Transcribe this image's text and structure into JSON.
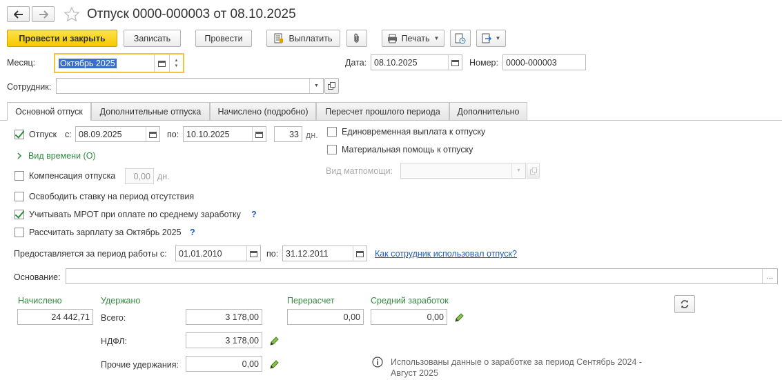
{
  "header": {
    "back_icon": "arrow-left-icon",
    "forward_icon": "arrow-right-icon",
    "star_icon": "star-icon",
    "title": "Отпуск 0000-000003 от 08.10.2025"
  },
  "toolbar": {
    "post_close_label": "Провести и закрыть",
    "save_label": "Записать",
    "post_label": "Провести",
    "pay_label": "Выплатить",
    "print_label": "Печать"
  },
  "fields": {
    "month_label": "Месяц:",
    "month_value": "Октябрь 2025",
    "date_label": "Дата:",
    "date_value": "08.10.2025",
    "number_label": "Номер:",
    "number_value": "0000-000003",
    "employee_label": "Сотрудник:",
    "employee_value": ""
  },
  "tabs": [
    {
      "label": "Основной отпуск"
    },
    {
      "label": "Дополнительные отпуска"
    },
    {
      "label": "Начислено (подробно)"
    },
    {
      "label": "Пересчет прошлого периода"
    },
    {
      "label": "Дополнительно"
    }
  ],
  "main": {
    "vacation_label": "Отпуск",
    "from_label": "с:",
    "from_value": "08.09.2025",
    "to_label": "по:",
    "to_value": "10.10.2025",
    "days_value": "33",
    "days_unit": "дн.",
    "time_type_label": "Вид времени (О)",
    "compensation_label": "Компенсация отпуска",
    "compensation_value": "0,00",
    "compensation_unit": "дн.",
    "release_rate_label": "Освободить ставку на период отсутствия",
    "mrot_label": "Учитывать МРОТ при оплате по среднему заработку",
    "calc_salary_label": "Рассчитать зарплату за Октябрь 2025",
    "help_mark": "?",
    "one_time_label": "Единовременная выплата к отпуску",
    "material_help_label": "Материальная помощь к отпуску",
    "material_type_label": "Вид матпомощи:",
    "material_type_value": "",
    "period_label": "Предоставляется за период работы с:",
    "period_from": "01.01.2010",
    "period_to_label": "по:",
    "period_to": "31.12.2011",
    "usage_link": "Как сотрудник использовал отпуск?",
    "basis_label": "Основание:",
    "basis_value": "",
    "basis_btn": "..."
  },
  "totals": {
    "accrued_label": "Начислено",
    "accrued_value": "24 442,71",
    "withheld_label": "Удержано",
    "total_label": "Всего:",
    "total_value": "3 178,00",
    "ndfl_label": "НДФЛ:",
    "ndfl_value": "3 178,00",
    "other_label": "Прочие удержания:",
    "other_value": "0,00",
    "recalc_label": "Перерасчет",
    "recalc_value": "0,00",
    "avg_label": "Средний заработок",
    "avg_value": "0,00",
    "info_text": "Использованы данные о заработке за период Сентябрь 2024 -",
    "info_text_2": "Август 2025"
  },
  "colors": {
    "primary": "#f5c800",
    "accent_green": "#2e8b3c",
    "link": "#1a5eb8"
  }
}
